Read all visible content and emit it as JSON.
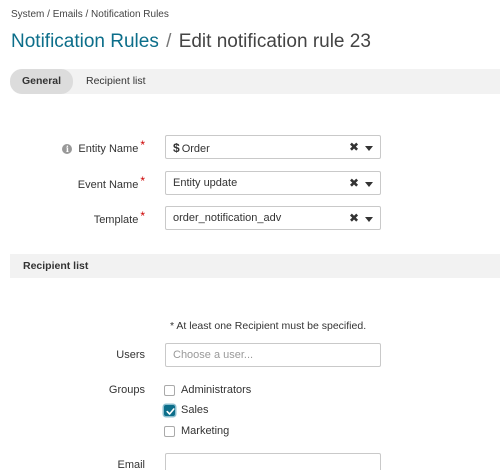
{
  "breadcrumb": {
    "items": [
      "System",
      "Emails",
      "Notification Rules"
    ],
    "separator": "/"
  },
  "title": {
    "entity": "Notification Rules",
    "separator": "/",
    "action": "Edit notification rule 23"
  },
  "tabs": [
    {
      "label": "General",
      "active": true
    },
    {
      "label": "Recipient list",
      "active": false
    }
  ],
  "general": {
    "entity_name": {
      "label": "Entity Name",
      "required": "*",
      "value": "Order",
      "value_prefix": "$"
    },
    "event_name": {
      "label": "Event Name",
      "required": "*",
      "value": "Entity update"
    },
    "template": {
      "label": "Template",
      "required": "*",
      "value": "order_notification_adv"
    }
  },
  "recipients": {
    "section_title": "Recipient list",
    "note": "* At least one Recipient must be specified.",
    "users": {
      "label": "Users",
      "placeholder": "Choose a user..."
    },
    "groups": {
      "label": "Groups",
      "options": [
        {
          "label": "Administrators",
          "checked": false
        },
        {
          "label": "Sales",
          "checked": true
        },
        {
          "label": "Marketing",
          "checked": false
        }
      ]
    },
    "email": {
      "label": "Email",
      "value": ""
    }
  },
  "colors": {
    "accent": "#0c6e8a",
    "required": "#cc0000",
    "panel_bg": "#f2f2f2"
  },
  "icons": [
    "info-icon",
    "clear-icon",
    "caret-down-icon",
    "checkmark-icon"
  ]
}
